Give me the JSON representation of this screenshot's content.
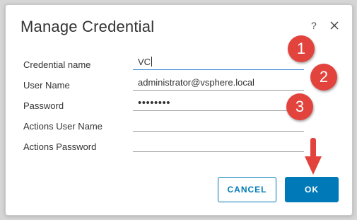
{
  "dialog": {
    "title": "Manage Credential",
    "help_symbol": "?",
    "close_icon": "close-icon"
  },
  "form": {
    "fields": [
      {
        "label": "Credential name",
        "value": "VC"
      },
      {
        "label": "User Name",
        "value": "administrator@vsphere.local"
      },
      {
        "label": "Password",
        "value": "••••••••"
      },
      {
        "label": "Actions User Name",
        "value": ""
      },
      {
        "label": "Actions Password",
        "value": ""
      }
    ]
  },
  "buttons": {
    "cancel_label": "CANCEL",
    "ok_label": "OK"
  },
  "annotations": {
    "steps": [
      "1",
      "2",
      "3"
    ],
    "marker_color": "#e2433d",
    "arrow_icon": "arrow-down-icon"
  },
  "colors": {
    "accent": "#0079b8",
    "focus_underline": "#3a8bd0"
  }
}
